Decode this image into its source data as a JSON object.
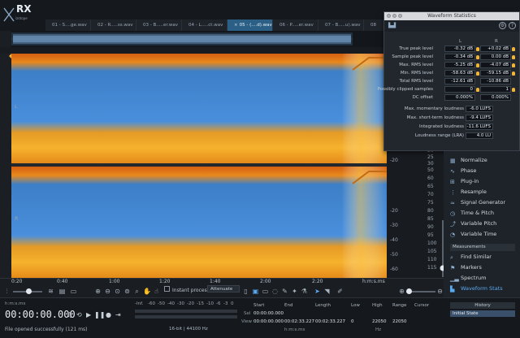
{
  "app": {
    "logo_text": "RX",
    "logo_sub": "izotope"
  },
  "tabs": [
    {
      "label": "01 - S....ge.wav"
    },
    {
      "label": "02 - R.....ss.wav"
    },
    {
      "label": "03 - B.....er.wav"
    },
    {
      "label": "04 - L.....ct.wav"
    },
    {
      "label": "05 - (....d).wav",
      "active": true,
      "close": "×"
    },
    {
      "label": "06 - P.....er.wav"
    },
    {
      "label": "07 - B.....u).wav"
    },
    {
      "label": "08"
    }
  ],
  "channels": {
    "left": "L",
    "right": "R"
  },
  "db_axis": {
    "labels": [
      "15",
      "20",
      "25",
      "30",
      "35",
      "40",
      "45",
      "50",
      "55",
      "60",
      "65",
      "70",
      "75",
      "80",
      "85",
      "90",
      "95",
      "100",
      "105",
      "110",
      "115"
    ],
    "top_ticks": [
      "-20",
      "-30",
      "-40",
      "-50",
      "-60"
    ]
  },
  "waveform_statistics": {
    "title": "Waveform Statistics",
    "col_left": "L",
    "col_right": "R",
    "rows": [
      {
        "label": "True peak level",
        "l": "-0.32 dB",
        "r": "+0.02 dB"
      },
      {
        "label": "Sample peak level",
        "l": "-0.34 dB",
        "r": "0.00 dB"
      },
      {
        "label": "Max. RMS level",
        "l": "-5.25 dB",
        "r": "-4.07 dB"
      },
      {
        "label": "Min. RMS level",
        "l": "-58.63 dB",
        "r": "-59.15 dB"
      },
      {
        "label": "Total RMS level",
        "l": "-12.61 dB",
        "r": "-10.86 dB"
      },
      {
        "label": "Possibly clipped samples",
        "l": "0",
        "r": "1"
      },
      {
        "label": "DC offset",
        "l": "0.000%",
        "r": "0.000%"
      }
    ],
    "loudness": [
      {
        "label": "Max. momentary loudness",
        "value": "-6.0 LUFS"
      },
      {
        "label": "Max. short-term loudness",
        "value": "-9.4 LUFS"
      },
      {
        "label": "Integrated loudness",
        "value": "-11.6 LUFS"
      },
      {
        "label": "Loudness range (LRA)",
        "value": "4.0 LU"
      }
    ]
  },
  "modules": [
    {
      "label": "Normalize",
      "icon": "normalize-icon"
    },
    {
      "label": "Phase",
      "icon": "phase-icon"
    },
    {
      "label": "Plug-in",
      "icon": "plugin-icon"
    },
    {
      "label": "Resample",
      "icon": "resample-icon"
    },
    {
      "label": "Signal Generator",
      "icon": "signal-generator-icon"
    },
    {
      "label": "Time & Pitch",
      "icon": "time-pitch-icon"
    },
    {
      "label": "Variable Pitch",
      "icon": "variable-pitch-icon"
    },
    {
      "label": "Variable Time",
      "icon": "variable-time-icon"
    }
  ],
  "measurements": {
    "header": "Measurements",
    "items": [
      {
        "label": "Find Similar",
        "icon": "find-similar-icon"
      },
      {
        "label": "Markers",
        "icon": "markers-icon"
      },
      {
        "label": "Spectrum",
        "icon": "spectrum-icon"
      },
      {
        "label": "Waveform Stats",
        "icon": "waveform-stats-icon",
        "selected": true
      }
    ]
  },
  "toolbar": {
    "instant_process": "Instant process",
    "attenuate": "Attenuate",
    "timeline_unit": "h:m:s.ms",
    "time_labels": [
      "0:20",
      "0:40",
      "1:00",
      "1:20",
      "1:40",
      "2:00",
      "2:20"
    ]
  },
  "transport": {
    "format": "h:m:s.ms",
    "time": "00:00:00.000",
    "status": "File opened successfully (121 ms)",
    "bit_rate": "16-bit | 44100 Hz",
    "meter_ticks": [
      "-Inf.",
      "-60",
      "-50",
      "-40",
      "-30",
      "-20",
      "-15",
      "-10",
      "-6",
      "-3",
      "0"
    ]
  },
  "selection": {
    "headers": [
      "Start",
      "End",
      "Length",
      "Low",
      "High",
      "Range",
      "Cursor"
    ],
    "sel_label": "Sel",
    "view_label": "View",
    "sel": {
      "start": "00:00:00.000",
      "end": "",
      "length": "",
      "low": "",
      "high": "",
      "range": ""
    },
    "view": {
      "start": "00:00:00.000",
      "end": "00:02:33.227",
      "length": "00:02:33.227",
      "low": "0",
      "high": "22050",
      "range": "22050"
    },
    "unit_time": "h:m:s.ms",
    "unit_hz": "Hz"
  },
  "history": {
    "title": "History",
    "item": "Initial State"
  }
}
